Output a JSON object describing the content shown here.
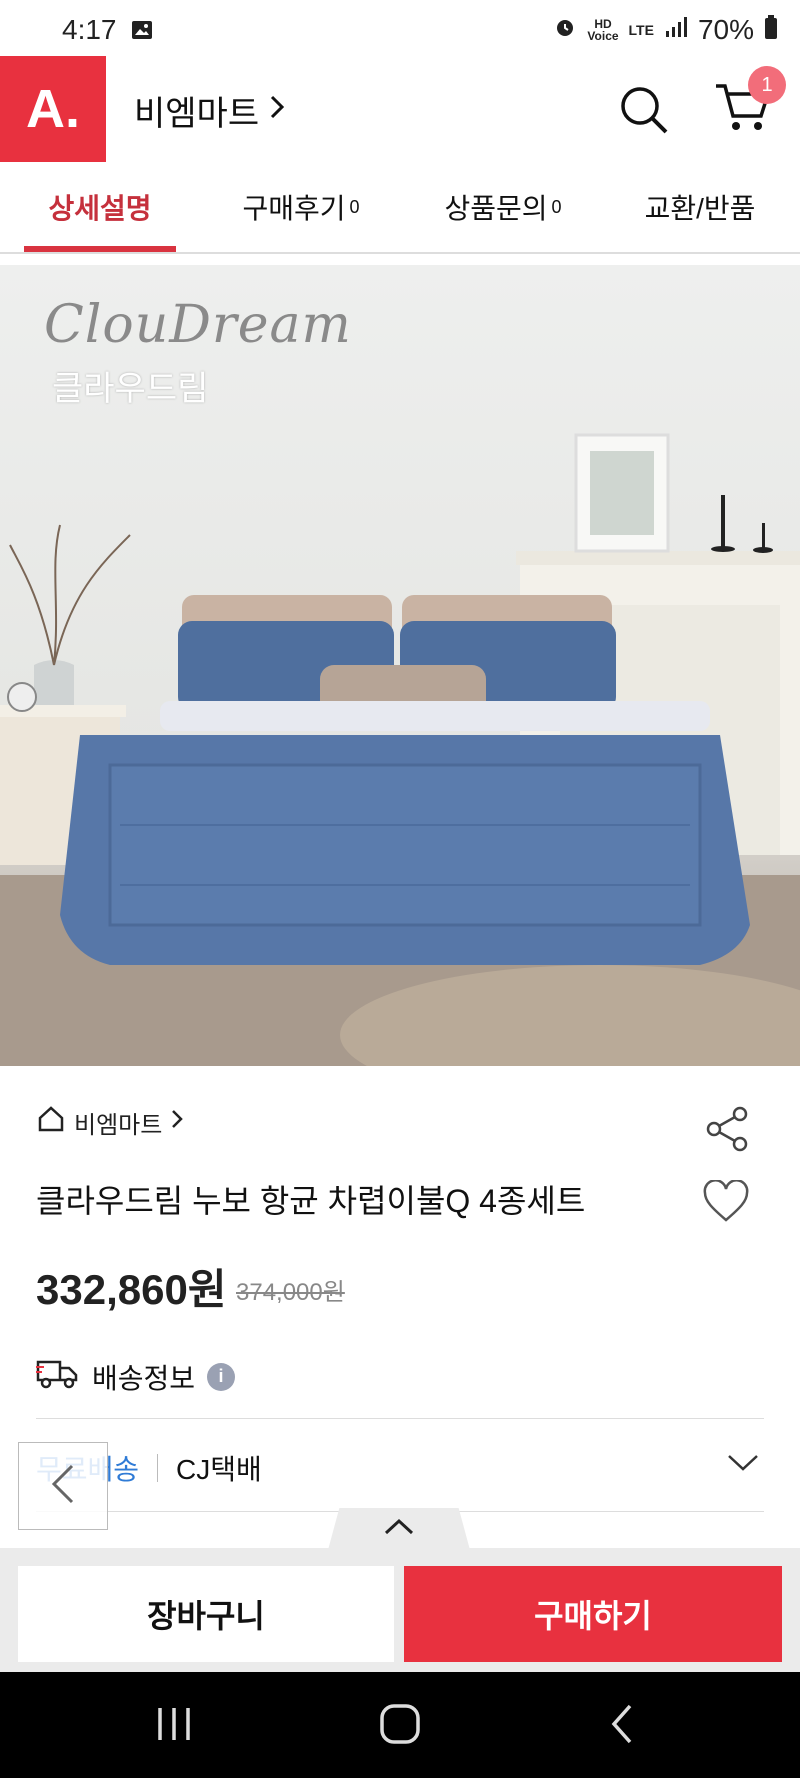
{
  "status_bar": {
    "time": "4:17",
    "battery": "70%"
  },
  "header": {
    "logo": "A.",
    "store_name": "비엠마트",
    "cart_count": "1"
  },
  "tabs": [
    {
      "label": "상세설명",
      "count": ""
    },
    {
      "label": "구매후기",
      "count": "0"
    },
    {
      "label": "상품문의",
      "count": "0"
    },
    {
      "label": "교환/반품",
      "count": ""
    }
  ],
  "hero": {
    "brand_en": "ClouDream",
    "brand_ko": "클라우드림"
  },
  "product": {
    "store_link": "비엠마트",
    "title": "클라우드림 누보 항균 차렵이불Q 4종세트",
    "price": "332,860원",
    "original_price": "374,000원"
  },
  "shipping": {
    "label": "배송정보",
    "info_icon": "i",
    "free": "무료배송",
    "carrier": "CJ택배"
  },
  "actions": {
    "cart": "장바구니",
    "buy": "구매하기"
  },
  "colors": {
    "brand_red": "#e8313f",
    "badge": "#f26d7a",
    "link_blue": "#2f7bd6"
  }
}
